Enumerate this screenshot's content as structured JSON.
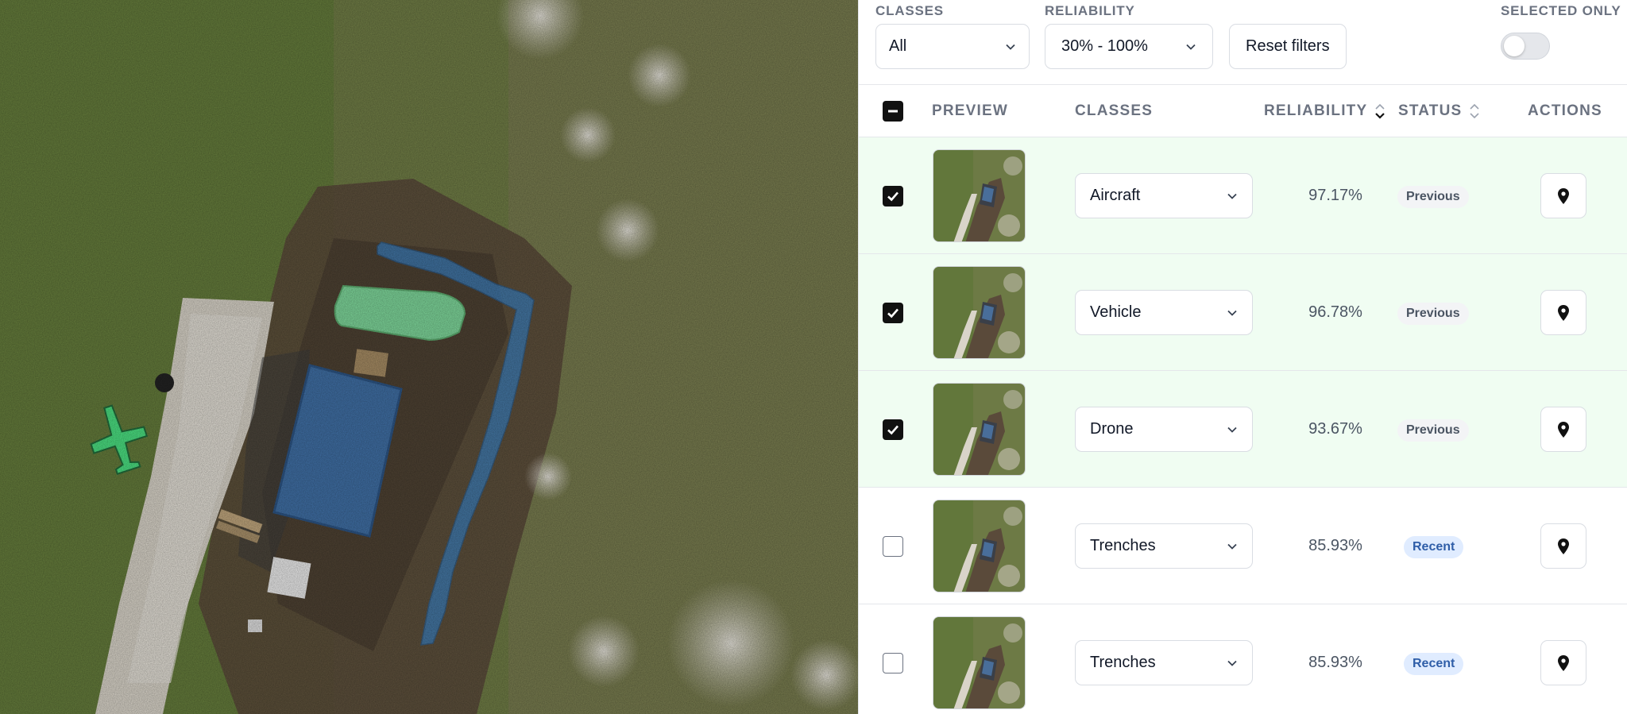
{
  "map": {
    "detections": [
      {
        "class": "Aircraft",
        "color": "#4ade80"
      },
      {
        "class": "Vehicle",
        "color": "#86efac"
      },
      {
        "class": "Trenches",
        "color": "#3b82c4"
      }
    ]
  },
  "filters": {
    "classes_label": "CLASSES",
    "classes_value": "All",
    "reliability_label": "RELIABILITY",
    "reliability_value": "30% - 100%",
    "reset_label": "Reset filters",
    "selected_only_label": "SELECTED ONLY",
    "selected_only": false
  },
  "table": {
    "headers": {
      "preview": "PREVIEW",
      "classes": "CLASSES",
      "reliability": "RELIABILITY",
      "status": "STATUS",
      "actions": "ACTIONS"
    },
    "rows": [
      {
        "checked": true,
        "class": "Aircraft",
        "reliability": "97.17%",
        "status": "Previous"
      },
      {
        "checked": true,
        "class": "Vehicle",
        "reliability": "96.78%",
        "status": "Previous"
      },
      {
        "checked": true,
        "class": "Drone",
        "reliability": "93.67%",
        "status": "Previous"
      },
      {
        "checked": false,
        "class": "Trenches",
        "reliability": "85.93%",
        "status": "Recent"
      },
      {
        "checked": false,
        "class": "Trenches",
        "reliability": "85.93%",
        "status": "Recent"
      }
    ]
  },
  "colors": {
    "selected_row_bg": "#f0fdf2",
    "recent_badge_bg": "#e0ecff",
    "recent_badge_text": "#2f5ea8",
    "previous_badge_bg": "#f3f4f6"
  },
  "icons": {
    "select_chevron": "chevron-down-icon",
    "sort": "sort-icon",
    "action": "map-pin-icon",
    "checkbox": "check-icon"
  }
}
